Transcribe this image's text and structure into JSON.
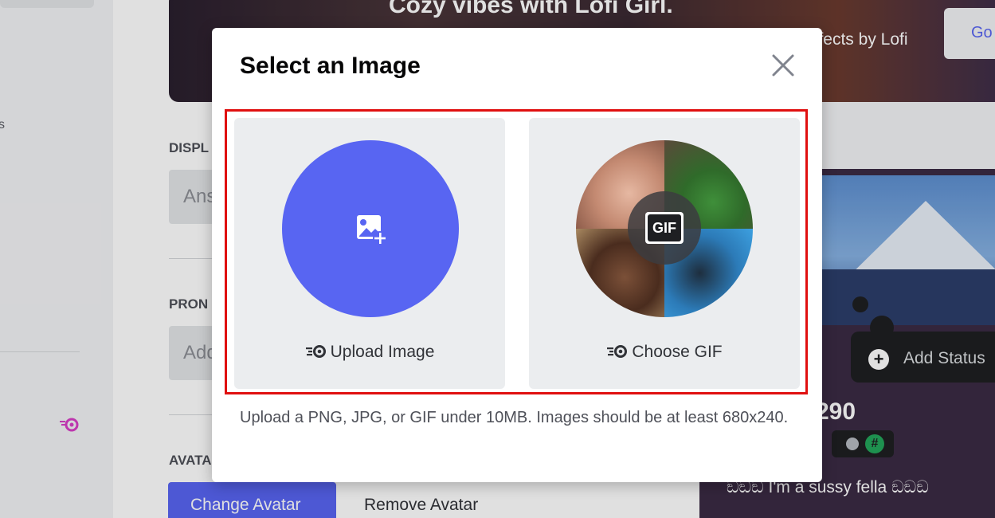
{
  "background": {
    "banner_title": "Cozy vibes with Lofi Girl.",
    "banner_sub": "ffects by Lofi",
    "banner_button": "Go",
    "section_label_display": "DISPL",
    "display_input_value": "Ans",
    "section_label_pronouns": "PRON",
    "pronouns_placeholder": "Add",
    "section_label_avatar": "AVATA",
    "change_avatar_label": "Change Avatar",
    "remove_avatar_label": "Remove Avatar",
    "sidebar_letter": "s",
    "preview": {
      "add_status_label": "Add Status",
      "username_suffix": "290",
      "badge_hash": "#",
      "bio": "ඞඞඞ I'm a sussy fella ඞඞඞ"
    }
  },
  "modal": {
    "title": "Select an Image",
    "close_icon": "close-icon",
    "options": {
      "upload_label": "Upload Image",
      "gif_label": "Choose GIF",
      "gif_badge": "GIF"
    },
    "help_text": "Upload a PNG, JPG, or GIF under 10MB. Images should be at least 680x240."
  },
  "colors": {
    "accent": "#5865f2",
    "highlight_border": "#e01010",
    "option_bg": "#ebedef"
  }
}
